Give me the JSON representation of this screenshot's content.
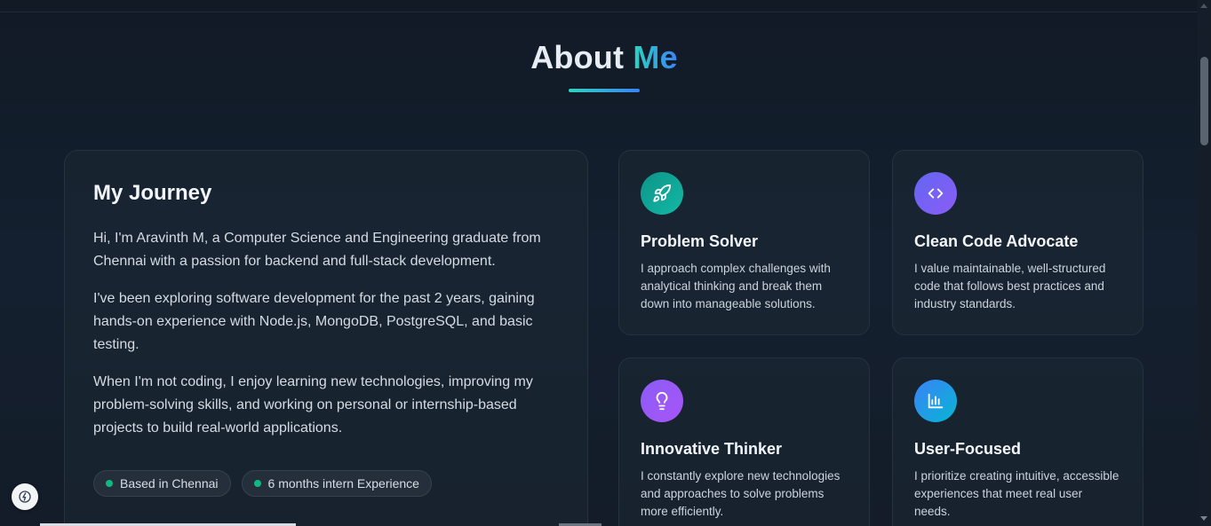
{
  "section": {
    "title_main": "About",
    "title_accent": "Me"
  },
  "journey": {
    "title": "My Journey",
    "paragraphs": [
      "Hi, I'm Aravinth M, a Computer Science and Engineering graduate from Chennai with a passion for backend and full-stack development.",
      "I've been exploring software development for the past 2 years, gaining hands-on experience with Node.js, MongoDB, PostgreSQL, and basic testing.",
      "When I'm not coding, I enjoy learning new technologies, improving my problem-solving skills, and working on personal or internship-based projects to build real-world applications."
    ],
    "badges": [
      {
        "label": "Based in Chennai"
      },
      {
        "label": "6 months intern Experience"
      }
    ]
  },
  "features": [
    {
      "title": "Problem Solver",
      "description": "I approach complex challenges with analytical thinking and break them down into manageable solutions.",
      "icon": "rocket-icon",
      "gradient": [
        "#0d9488",
        "#14b8a6"
      ]
    },
    {
      "title": "Clean Code Advocate",
      "description": "I value maintainable, well-structured code that follows best practices and industry standards.",
      "icon": "code-icon",
      "gradient": [
        "#6366f1",
        "#8b5cf6"
      ]
    },
    {
      "title": "Innovative Thinker",
      "description": "I constantly explore new technologies and approaches to solve problems more efficiently.",
      "icon": "lightbulb-icon",
      "gradient": [
        "#8b5cf6",
        "#a855f7"
      ]
    },
    {
      "title": "User-Focused",
      "description": "I prioritize creating intuitive, accessible experiences that meet real user needs.",
      "icon": "bar-chart-icon",
      "gradient": [
        "#3b82f6",
        "#06b6d4"
      ]
    }
  ],
  "colors": {
    "background": "#131c28",
    "accent_start": "#2dd4bf",
    "accent_end": "#3b82f6",
    "badge_dot": "#10b981"
  }
}
